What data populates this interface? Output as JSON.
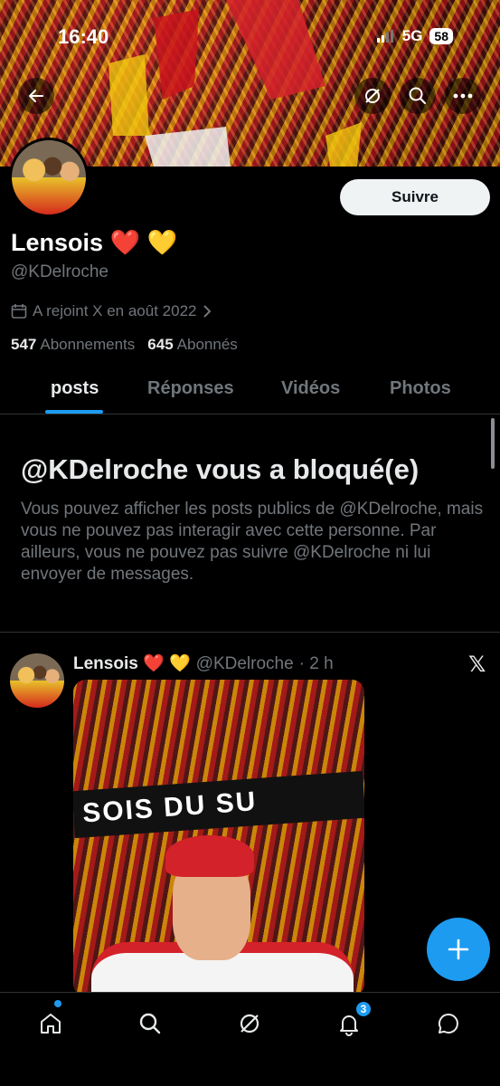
{
  "status_bar": {
    "time": "16:40",
    "network": "5G",
    "battery": "58"
  },
  "profile": {
    "follow_label": "Suivre",
    "name": "Lensois ❤️ 💛",
    "handle": "@KDelroche",
    "joined": "A rejoint X en août 2022",
    "following_count": "547",
    "following_label": "Abonnements",
    "followers_count": "645",
    "followers_label": "Abonnés"
  },
  "tabs": [
    {
      "label": "posts",
      "active": true
    },
    {
      "label": "Réponses",
      "active": false
    },
    {
      "label": "Vidéos",
      "active": false
    },
    {
      "label": "Photos",
      "active": false
    }
  ],
  "blocked_notice": {
    "title": "@KDelroche vous a bloqué(e)",
    "body": "Vous pouvez afficher les posts publics de @KDelroche, mais vous ne pouvez pas interagir avec cette personne. Par ailleurs, vous ne pouvez pas suivre @KDelroche ni lui envoyer de messages."
  },
  "tweet": {
    "name": "Lensois ❤️ 💛",
    "handle": "@KDelroche",
    "time": "· 2 h",
    "x_logo": "𝕏",
    "media_text": "SOIS DU SU"
  },
  "fab_label": "+",
  "bottom_nav": {
    "notification_badge": "3"
  },
  "colors": {
    "accent": "#1d9bf0",
    "background": "#000000",
    "secondary_text": "#71767b"
  }
}
